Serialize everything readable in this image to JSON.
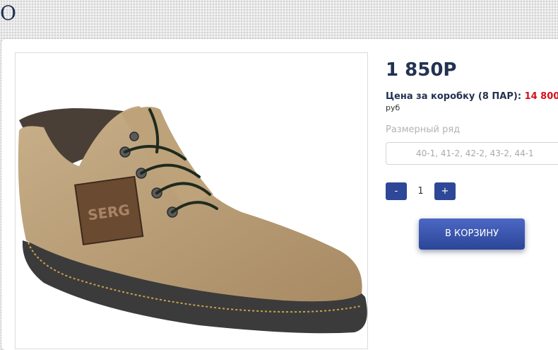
{
  "header": {
    "title": "О"
  },
  "product": {
    "image_alt": "SERG",
    "price": "1 850Р",
    "box_label": "Цена за коробку (8 ПАР):",
    "box_amount": "14 800",
    "currency": "руб",
    "size_label": "Размерный ряд",
    "sizes": "40-1, 41-2, 42-2, 43-2, 44-1"
  },
  "quantity": {
    "minus": "-",
    "value": "1",
    "plus": "+"
  },
  "cart": {
    "button_label": "В КОРЗИНУ"
  },
  "colors": {
    "accent": "#2e4897",
    "price_red": "#d4101b",
    "text_dark": "#233252"
  }
}
